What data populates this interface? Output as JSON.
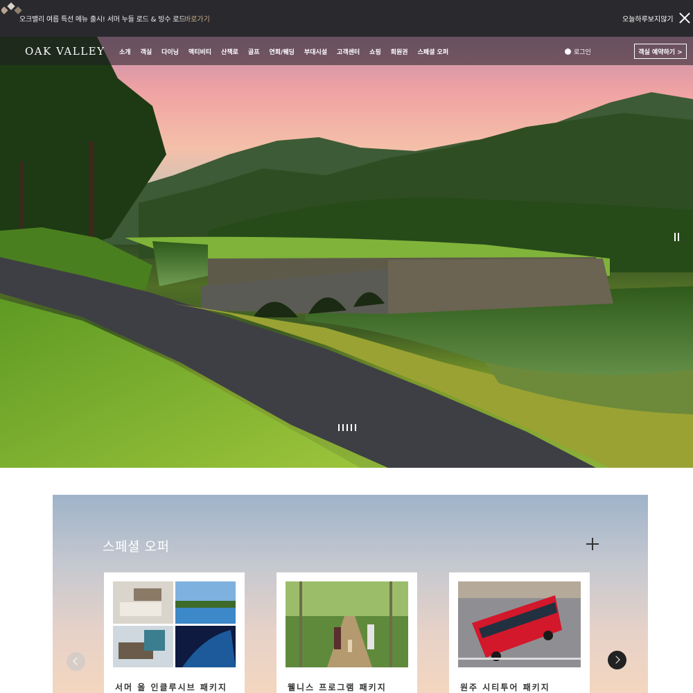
{
  "notice": {
    "message": "오크밸리 여름 특선 메뉴 출시! 서머 누들 로드 & 빙수 로드",
    "go_label": "바로가기",
    "hide_today": "오늘하루보지않기"
  },
  "nav": {
    "brand": "OAK VALLEY",
    "items": [
      "소개",
      "객실",
      "다이닝",
      "액티비티",
      "산책로",
      "골프",
      "연회/웨딩",
      "부대시설",
      "고객센터",
      "쇼핑",
      "회원권",
      "스페셜 오퍼"
    ],
    "login": "로그인",
    "reserve": "객실 예약하기 >"
  },
  "hero": {
    "slide_count": 5
  },
  "offers": {
    "title": "스페셜 오퍼",
    "cards": [
      {
        "label": "서머 올 인클루시브 패키지"
      },
      {
        "label": "웰니스 프로그램 패키지"
      },
      {
        "label": "원주 시티투어 패키지"
      }
    ]
  },
  "icons": {
    "close": "close-icon",
    "user": "user-icon",
    "plus": "plus-icon",
    "prev": "chevron-left-icon",
    "next": "chevron-right-icon"
  }
}
